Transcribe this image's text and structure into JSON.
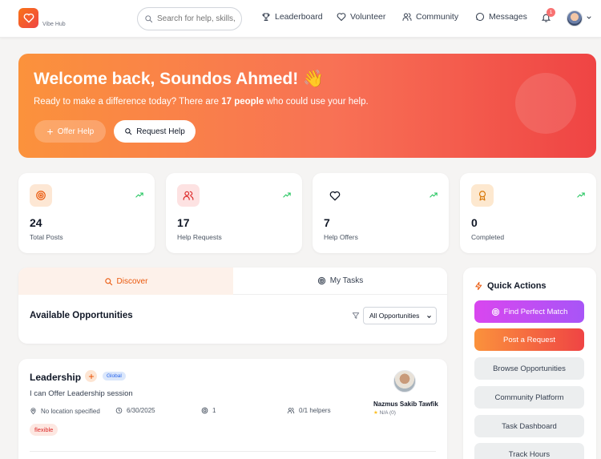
{
  "app": {
    "brand": "Vibe Hub"
  },
  "colors": {
    "accent": "#f97316",
    "brand_gradient": [
      "#fb923c",
      "#ef4444"
    ],
    "match_gradient": [
      "#d946ef",
      "#a855f7"
    ]
  },
  "nav": {
    "search_placeholder": "Search for help, skills, c",
    "links": [
      {
        "label": "Leaderboard",
        "icon": "trophy-icon"
      },
      {
        "label": "Volunteer",
        "icon": "heart-icon"
      },
      {
        "label": "Community",
        "icon": "users-icon"
      },
      {
        "label": "Messages",
        "icon": "message-icon"
      }
    ],
    "notification_count": "1"
  },
  "hero": {
    "greeting": "Welcome back, Soundos Ahmed! 👋",
    "sub_before": "Ready to make a difference today? There are ",
    "sub_count": "17 people",
    "sub_after": " who could use your help.",
    "offer_label": "Offer Help",
    "request_label": "Request Help"
  },
  "stats": [
    {
      "value": "24",
      "label": "Total Posts",
      "icon": "target-icon"
    },
    {
      "value": "17",
      "label": "Help Requests",
      "icon": "users-icon"
    },
    {
      "value": "7",
      "label": "Help Offers",
      "icon": "heart-icon"
    },
    {
      "value": "0",
      "label": "Completed",
      "icon": "award-icon"
    }
  ],
  "tabs": {
    "discover": "Discover",
    "my_tasks": "My Tasks",
    "active": "discover"
  },
  "opportunities": {
    "title": "Available Opportunities",
    "filter_value": "All Opportunities",
    "items": [
      {
        "title": "Leadership",
        "scope": "Global",
        "description": "I can Offer Leadership session",
        "location": "No location specified",
        "date": "6/30/2025",
        "count": "1",
        "helpers": "0/1 helpers",
        "tag": "flexible",
        "author": "Nazmus Sakib Tawfik",
        "rating": "N/A",
        "rating_count": "(0)"
      }
    ]
  },
  "quick_actions": {
    "title": "Quick Actions",
    "find_match": "Find Perfect Match",
    "post_request": "Post a Request",
    "others": [
      "Browse Opportunities",
      "Community Platform",
      "Task Dashboard",
      "Track Hours"
    ]
  }
}
